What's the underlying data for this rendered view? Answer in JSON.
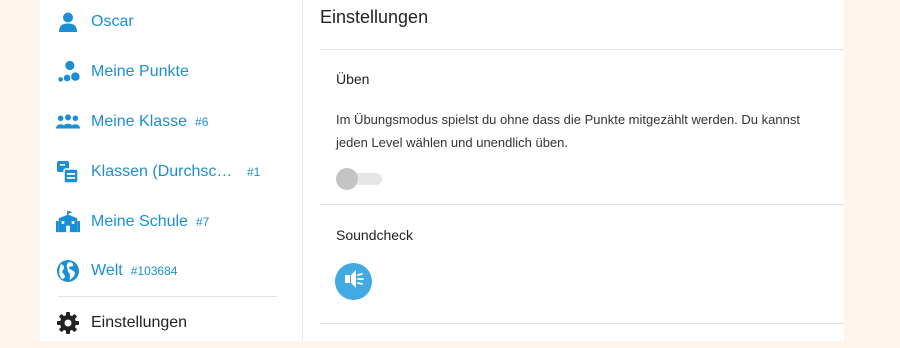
{
  "sidebar": {
    "items": [
      {
        "label": "Oscar",
        "rank": "",
        "icon": "user-icon"
      },
      {
        "label": "Meine Punkte",
        "rank": "",
        "icon": "points-icon"
      },
      {
        "label": "Meine Klasse",
        "rank": "#6",
        "icon": "class-group-icon"
      },
      {
        "label": "Klassen (Durchschnitt)",
        "rank": "#1",
        "icon": "classes-average-icon"
      },
      {
        "label": "Meine Schule",
        "rank": "#7",
        "icon": "school-icon"
      },
      {
        "label": "Welt",
        "rank": "#103684",
        "icon": "globe-icon"
      },
      {
        "label": "Einstellungen",
        "rank": "",
        "icon": "gear-icon"
      }
    ]
  },
  "main": {
    "title": "Einstellungen",
    "practice": {
      "title": "Üben",
      "description": "Im Übungsmodus spielst du ohne dass die Punkte mitgezählt werden. Du kannst jeden Level wählen und unendlich üben.",
      "toggle_on": false
    },
    "soundcheck": {
      "title": "Soundcheck",
      "icon": "speaker-icon"
    }
  },
  "colors": {
    "accent": "#1b8fd4",
    "sound_button": "#43a9e2",
    "background": "#fdf4ee"
  }
}
